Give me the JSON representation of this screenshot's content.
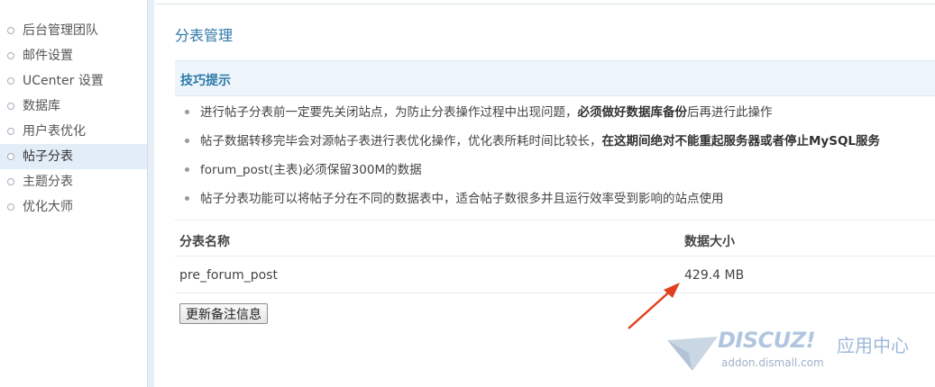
{
  "sidebar": {
    "items": [
      {
        "label": "后台管理团队"
      },
      {
        "label": "邮件设置"
      },
      {
        "label": "UCenter 设置"
      },
      {
        "label": "数据库"
      },
      {
        "label": "用户表优化"
      },
      {
        "label": "帖子分表",
        "active": true
      },
      {
        "label": "主题分表"
      },
      {
        "label": "优化大师"
      }
    ]
  },
  "main": {
    "title": "分表管理",
    "tips": {
      "header": "技巧提示",
      "items": [
        {
          "pre": "进行帖子分表前一定要先关闭站点，为防止分表操作过程中出现问题，",
          "bold": "必须做好数据库备份",
          "post": "后再进行此操作"
        },
        {
          "pre": "帖子数据转移完毕会对源帖子表进行表优化操作，优化表所耗时间比较长，",
          "bold": "在这期间绝对不能重起服务器或者停止MySQL服务",
          "post": ""
        },
        {
          "pre": "forum_post(主表)必须保留300M的数据",
          "bold": "",
          "post": ""
        },
        {
          "pre": "帖子分表功能可以将帖子分在不同的数据表中，适合帖子数很多并且运行效率受到影响的站点使用",
          "bold": "",
          "post": ""
        }
      ]
    },
    "table": {
      "headers": {
        "name": "分表名称",
        "size": "数据大小"
      },
      "rows": [
        {
          "name": "pre_forum_post",
          "size": "429.4 MB"
        }
      ]
    },
    "update_button": "更新备注信息"
  },
  "watermark": {
    "logo": "DISCUZ!",
    "app": "应用中心",
    "url": "addon.dismall.com"
  },
  "colors": {
    "accent": "#2c78a8",
    "arrow": "#e0401e",
    "active_bg": "#e2edf7",
    "tips_bg": "#edf5fb"
  }
}
